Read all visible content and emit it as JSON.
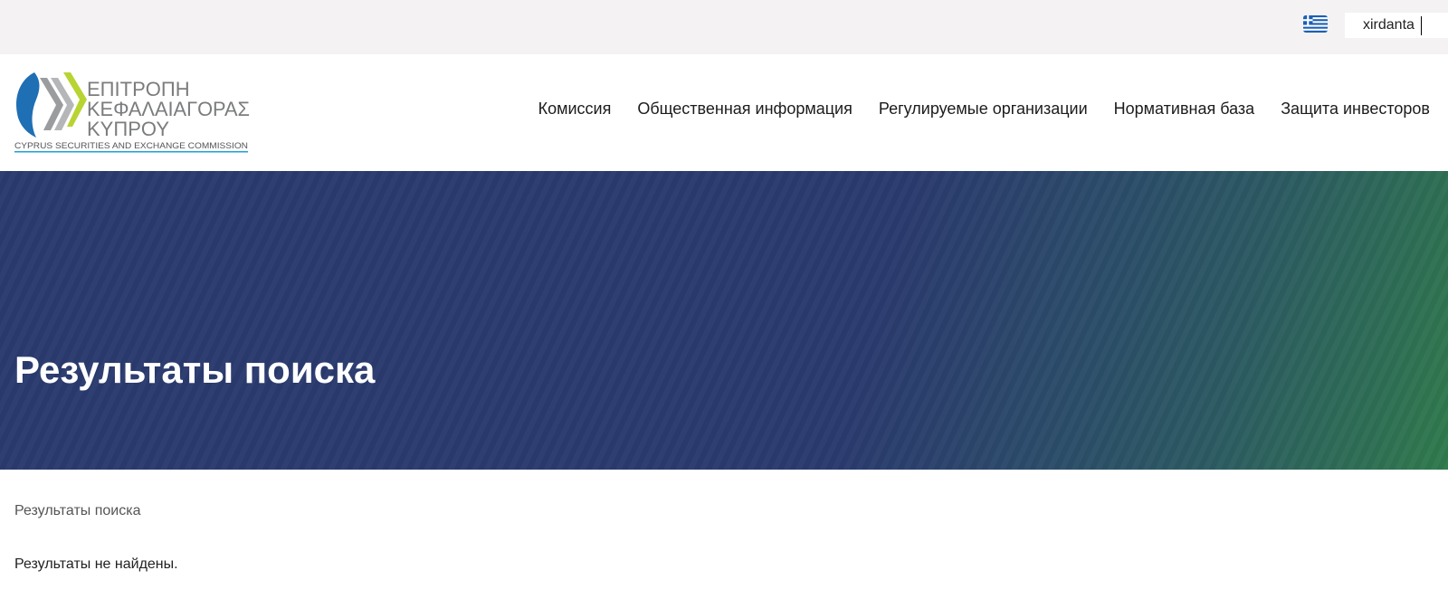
{
  "topbar": {
    "language_flag": "greece-flag-icon",
    "search_value": "xirdanta"
  },
  "logo": {
    "line1": "ΕΠΙΤΡΟΠΗ",
    "line2": "ΚΕΦΑΛΑΙΑΓΟΡΑΣ",
    "line3": "ΚΥΠΡΟΥ",
    "subtitle": "CYPRUS SECURITIES AND EXCHANGE COMMISSION"
  },
  "nav": {
    "items": [
      {
        "label": "Комиссия"
      },
      {
        "label": "Общественная информация"
      },
      {
        "label": "Регулируемые организации"
      },
      {
        "label": "Нормативная база"
      },
      {
        "label": "Защита инвесторов"
      }
    ]
  },
  "hero": {
    "title": "Результаты поиска"
  },
  "content": {
    "breadcrumb": "Результаты поиска",
    "message": "Результаты не найдены."
  },
  "colors": {
    "hero_blue": "#2a3a6e",
    "hero_green": "#2f7a4c",
    "logo_blue": "#1f6fb4",
    "logo_lime": "#b8d432",
    "logo_gray": "#8a8c8e"
  }
}
